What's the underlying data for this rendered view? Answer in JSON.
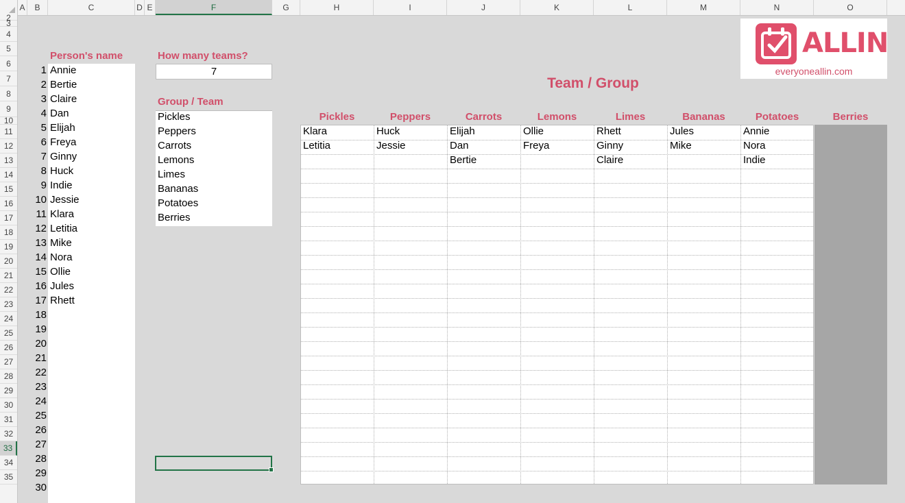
{
  "columns": [
    "A",
    "B",
    "C",
    "D",
    "E",
    "F",
    "G",
    "H",
    "I",
    "J",
    "K",
    "L",
    "M",
    "N",
    "O"
  ],
  "rows": [
    "2",
    "3",
    "4",
    "5",
    "6",
    "7",
    "8",
    "9",
    "10",
    "11",
    "12",
    "13",
    "14",
    "15",
    "16",
    "17",
    "18",
    "19",
    "20",
    "21",
    "22",
    "23",
    "24",
    "25",
    "26",
    "27",
    "28",
    "29",
    "30",
    "31",
    "32",
    "33",
    "34",
    "35"
  ],
  "selected": {
    "column": "F",
    "row": "33"
  },
  "person_header": "Person's name",
  "persons": [
    {
      "n": "1",
      "name": "Annie"
    },
    {
      "n": "2",
      "name": "Bertie"
    },
    {
      "n": "3",
      "name": "Claire"
    },
    {
      "n": "4",
      "name": "Dan"
    },
    {
      "n": "5",
      "name": "Elijah"
    },
    {
      "n": "6",
      "name": "Freya"
    },
    {
      "n": "7",
      "name": "Ginny"
    },
    {
      "n": "8",
      "name": "Huck"
    },
    {
      "n": "9",
      "name": "Indie"
    },
    {
      "n": "10",
      "name": "Jessie"
    },
    {
      "n": "11",
      "name": "Klara"
    },
    {
      "n": "12",
      "name": "Letitia"
    },
    {
      "n": "13",
      "name": "Mike"
    },
    {
      "n": "14",
      "name": "Nora"
    },
    {
      "n": "15",
      "name": "Ollie"
    },
    {
      "n": "16",
      "name": "Jules"
    },
    {
      "n": "17",
      "name": "Rhett"
    },
    {
      "n": "18",
      "name": ""
    },
    {
      "n": "19",
      "name": ""
    },
    {
      "n": "20",
      "name": ""
    },
    {
      "n": "21",
      "name": ""
    },
    {
      "n": "22",
      "name": ""
    },
    {
      "n": "23",
      "name": ""
    },
    {
      "n": "24",
      "name": ""
    },
    {
      "n": "25",
      "name": ""
    },
    {
      "n": "26",
      "name": ""
    },
    {
      "n": "27",
      "name": ""
    },
    {
      "n": "28",
      "name": ""
    },
    {
      "n": "29",
      "name": ""
    },
    {
      "n": "30",
      "name": ""
    }
  ],
  "teams_question": "How many teams?",
  "teams_count": "7",
  "group_header": "Group / Team",
  "groups": [
    "Pickles",
    "Peppers",
    "Carrots",
    "Lemons",
    "Limes",
    "Bananas",
    "Potatoes",
    "Berries"
  ],
  "title": "Team / Group",
  "team_columns": [
    {
      "name": "Pickles",
      "members": [
        "Klara",
        "Letitia"
      ]
    },
    {
      "name": "Peppers",
      "members": [
        "Huck",
        "Jessie"
      ]
    },
    {
      "name": "Carrots",
      "members": [
        "Elijah",
        "Dan",
        "Bertie"
      ]
    },
    {
      "name": "Lemons",
      "members": [
        "Ollie",
        "Freya"
      ]
    },
    {
      "name": "Limes",
      "members": [
        "Rhett",
        "Ginny",
        "Claire"
      ]
    },
    {
      "name": "Bananas",
      "members": [
        "Jules",
        "Mike"
      ]
    },
    {
      "name": "Potatoes",
      "members": [
        "Annie",
        "Nora",
        "Indie"
      ]
    },
    {
      "name": "Berries",
      "members": []
    }
  ],
  "logo": {
    "word": "ALLIN",
    "url": "everyoneallin.com"
  },
  "colors": {
    "accent": "#d14f6a",
    "selection": "#217346",
    "disabled_column": "#a6a6a6"
  }
}
